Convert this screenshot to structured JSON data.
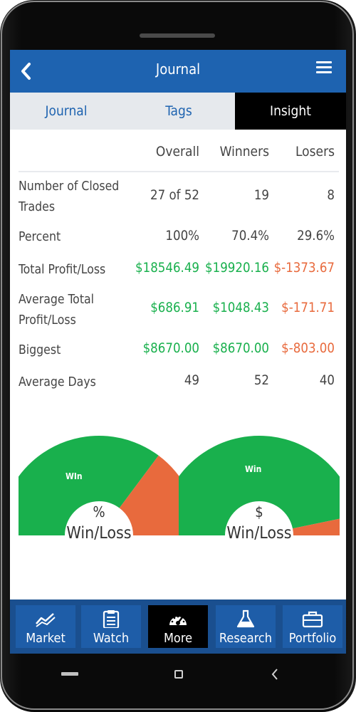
{
  "appbar": {
    "title": "Journal"
  },
  "tabs": [
    {
      "label": "Journal"
    },
    {
      "label": "Tags"
    },
    {
      "label": "Insight"
    }
  ],
  "stats": {
    "headers": [
      "Overall",
      "Winners",
      "Losers"
    ],
    "rows": [
      {
        "label": "Number of Closed Trades",
        "values": [
          "27 of 52",
          "19",
          "8"
        ]
      },
      {
        "label": "Percent",
        "values": [
          "100%",
          "70.4%",
          "29.6%"
        ]
      },
      {
        "label": "Total Profit/Loss",
        "values": [
          "$18546.49",
          "$19920.16",
          "$-1373.67"
        ]
      },
      {
        "label": "Average Total Profit/Loss",
        "values": [
          "$686.91",
          "$1048.43",
          "$-171.71"
        ]
      },
      {
        "label": "Biggest",
        "values": [
          "$8670.00",
          "$8670.00",
          "$-803.00"
        ]
      },
      {
        "label": "Average Days",
        "values": [
          "49",
          "52",
          "40"
        ]
      }
    ]
  },
  "gauges": [
    {
      "win_label": "WIn",
      "symbol": "%",
      "caption": "Win/Loss",
      "win_fraction": 0.704
    },
    {
      "win_label": "Win",
      "symbol": "$",
      "caption": "Win/Loss",
      "win_fraction": 0.935
    }
  ],
  "colors": {
    "primary": "#1e63b0",
    "win": "#19b04d",
    "loss": "#e86a3d",
    "text": "#444444"
  },
  "bottom_nav": [
    {
      "label": "Market",
      "icon": "chart-trend-icon"
    },
    {
      "label": "Watch",
      "icon": "clipboard-icon"
    },
    {
      "label": "More",
      "icon": "speedometer-icon"
    },
    {
      "label": "Research",
      "icon": "flask-icon"
    },
    {
      "label": "Portfolio",
      "icon": "briefcase-icon"
    }
  ]
}
